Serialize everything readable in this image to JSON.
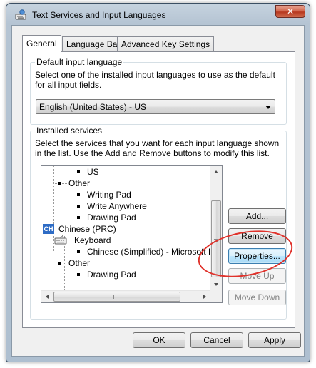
{
  "window": {
    "title": "Text Services and Input Languages",
    "close_label": "✕"
  },
  "tabs": [
    {
      "label": "General",
      "active": true
    },
    {
      "label": "Language Bar",
      "active": false
    },
    {
      "label": "Advanced Key Settings",
      "active": false
    }
  ],
  "default_input": {
    "group_title": "Default input language",
    "description": "Select one of the installed input languages to use as the default for all input fields.",
    "selected": "English (United States) - US"
  },
  "installed_services": {
    "group_title": "Installed services",
    "description": "Select the services that you want for each input language shown in the list. Use the Add and Remove buttons to modify this list.",
    "tree": [
      {
        "label": "US"
      },
      {
        "label": "Other"
      },
      {
        "label": "Writing Pad"
      },
      {
        "label": "Write Anywhere"
      },
      {
        "label": "Drawing Pad"
      },
      {
        "label": "Chinese (PRC)",
        "badge": "CH"
      },
      {
        "label": "Keyboard"
      },
      {
        "label": "Chinese (Simplified) - Microsoft Pinyin"
      },
      {
        "label": "Other"
      },
      {
        "label": "Drawing Pad"
      }
    ],
    "buttons": {
      "add": "Add...",
      "remove": "Remove",
      "properties": "Properties...",
      "move_up": "Move Up",
      "move_down": "Move Down"
    }
  },
  "footer": {
    "ok": "OK",
    "cancel": "Cancel",
    "apply": "Apply"
  },
  "colors": {
    "highlight_ellipse": "#e0322b",
    "language_badge": "#2e6cc5"
  }
}
